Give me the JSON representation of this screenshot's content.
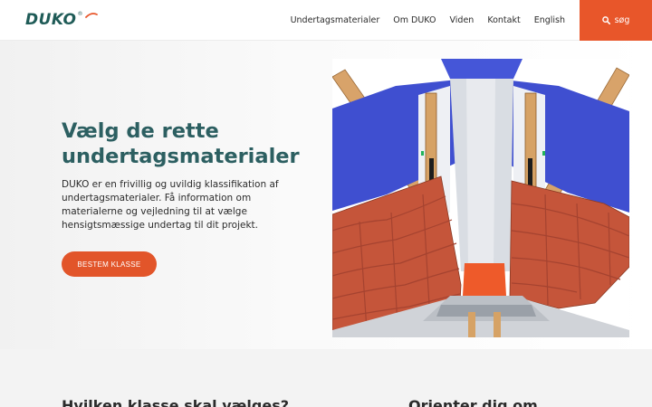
{
  "brand": {
    "name": "DUKO",
    "registered": "®"
  },
  "nav": {
    "items": [
      {
        "label": "Undertagsmaterialer"
      },
      {
        "label": "Om DUKO"
      },
      {
        "label": "Viden"
      },
      {
        "label": "Kontakt"
      },
      {
        "label": "English"
      }
    ]
  },
  "search": {
    "label": "søg",
    "icon": "search-icon"
  },
  "hero": {
    "title": "Vælg de rette undertagsmaterialer",
    "text": "DUKO er en frivillig og uvildig klassifikation af undertagsmaterialer. Få information om materialerne og vejledning til at vælge hensigtsmæssige undertag til dit projekt.",
    "cta_label": "BESTEM KLASSE"
  },
  "sections": {
    "left_heading": "Hvilken klasse skal vælges?",
    "right_heading": "Orienter dig om"
  },
  "colors": {
    "accent": "#e8562a",
    "brand": "#1f5b57",
    "title": "#2c5f61"
  }
}
